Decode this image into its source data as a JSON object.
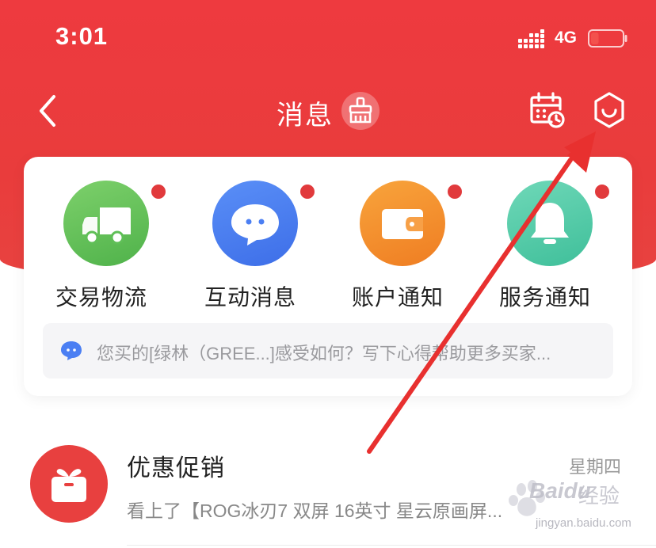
{
  "status_bar": {
    "time": "3:01",
    "network": "4G",
    "battery_level": 0.25
  },
  "nav": {
    "title": "消息",
    "icons": [
      "back-chevron-icon",
      "broom-icon",
      "calendar-clock-icon",
      "settings-hexagon-icon"
    ]
  },
  "categories": [
    {
      "label": "交易物流",
      "icon": "truck-icon",
      "color": "#62c25a",
      "has_badge": true
    },
    {
      "label": "互动消息",
      "icon": "chat-bubble-icon",
      "color": "#4b7ff3",
      "has_badge": true
    },
    {
      "label": "账户通知",
      "icon": "wallet-icon",
      "color": "#f4902b",
      "has_badge": true
    },
    {
      "label": "服务通知",
      "icon": "bell-icon",
      "color": "#4ec9a8",
      "has_badge": true
    }
  ],
  "latest_preview": {
    "text": "您买的[绿林（GREE...]感受如何？写下心得帮助更多买家..."
  },
  "messages": [
    {
      "title": "优惠促销",
      "day": "星期四",
      "preview": "看上了【ROG冰刃7 双屏 16英寸 星云原画屏...",
      "icon": "gift-box-icon"
    }
  ],
  "watermark": {
    "brand": "Baidu",
    "brand_cn": "经验",
    "url": "jingyan.baidu.com"
  },
  "colors": {
    "header_red": "#ea3c3e",
    "badge_red": "#e13a3c",
    "annotation_arrow": "#e8302f"
  }
}
